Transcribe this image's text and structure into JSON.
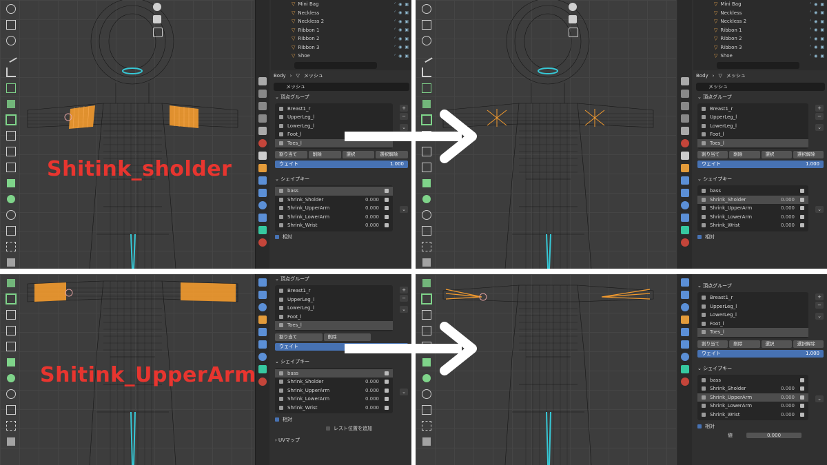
{
  "captions": {
    "top": "Shitink_sholder",
    "bottom": "Shitink_UpperArm"
  },
  "colors": {
    "caption": "#e8352f",
    "accent": "#4772b3",
    "selection": "#f29a2e",
    "vertex": "#36c8d6",
    "arrow": "#ffffff"
  },
  "outliner": {
    "items_tl": [
      "Mini Bag",
      "Neckless",
      "Neckless 2",
      "Ribbon 1",
      "Ribbon 2",
      "Ribbon 3",
      "Shoe"
    ],
    "items_tr": [
      "Mini Bag",
      "Neckless",
      "Neckless 2",
      "Ribbon 1",
      "Ribbon 2",
      "Ribbon 3",
      "Shoe"
    ]
  },
  "header": {
    "object": "Body",
    "data": "メッシュ",
    "mesh_name": "メッシュ"
  },
  "vertex_groups": {
    "title": "頂点グループ",
    "items": [
      "Breast1_r",
      "UpperLeg_l",
      "LowerLeg_l",
      "Foot_l",
      "Toes_l"
    ],
    "buttons": [
      "割り当て",
      "削除",
      "選択",
      "選択解除"
    ],
    "weight_label": "ウェイト",
    "weight_value": "1.000"
  },
  "shape_keys": {
    "title": "シェイプキー",
    "items": [
      {
        "name": "bass",
        "value": ""
      },
      {
        "name": "Shrink_Sholder",
        "value": "0.000"
      },
      {
        "name": "Shrink_UpperArm",
        "value": "0.000"
      },
      {
        "name": "Shrink_LowerArm",
        "value": "0.000"
      },
      {
        "name": "Shrink_Wrist",
        "value": "0.000"
      }
    ],
    "relative_label": "相対",
    "rest_label": "レスト位置を追加"
  },
  "uv_map": {
    "label": "UVマップ"
  },
  "br_extra": {
    "value_label": "値",
    "value": "0.000"
  }
}
